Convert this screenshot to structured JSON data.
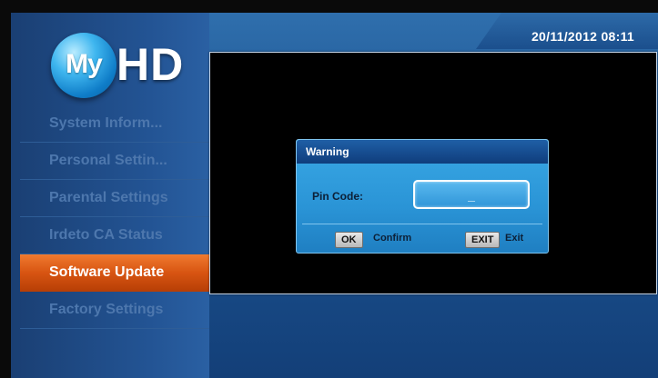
{
  "logo": {
    "my": "My",
    "hd": "HD"
  },
  "clock": "20/11/2012 08:11",
  "menu": [
    {
      "label": "System Inform...",
      "selected": false
    },
    {
      "label": "Personal Settin...",
      "selected": false
    },
    {
      "label": "Parental Settings",
      "selected": false
    },
    {
      "label": "Irdeto CA Status",
      "selected": false
    },
    {
      "label": "Software Update",
      "selected": true
    },
    {
      "label": "Factory Settings",
      "selected": false
    }
  ],
  "dialog": {
    "title": "Warning",
    "pin_label": "Pin Code:",
    "pin_value": "_",
    "ok_key": "OK",
    "ok_label": "Confirm",
    "exit_key": "EXIT",
    "exit_label": "Exit"
  }
}
